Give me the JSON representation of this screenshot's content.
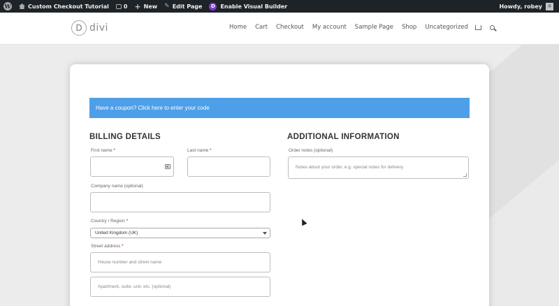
{
  "admin_bar": {
    "site_name": "Custom Checkout Tutorial",
    "comments_count": "0",
    "new_label": "New",
    "edit_page_label": "Edit Page",
    "visual_builder_label": "Enable Visual Builder",
    "greeting": "Howdy, robey"
  },
  "header": {
    "logo_letter": "D",
    "logo_text": "divi",
    "nav": [
      "Home",
      "Cart",
      "Checkout",
      "My account",
      "Sample Page",
      "Shop",
      "Uncategorized"
    ]
  },
  "checkout": {
    "coupon_text": "Have a coupon? Click here to enter your code",
    "billing": {
      "title": "BILLING DETAILS",
      "first_name_label": "First name",
      "last_name_label": "Last name",
      "company_label": "Company name (optional)",
      "country_label": "Country / Region",
      "country_value": "United Kingdom (UK)",
      "street_label": "Street address",
      "street_placeholder_1": "House number and street name",
      "street_placeholder_2": "Apartment, suite, unit, etc. (optional)",
      "required_mark": "*"
    },
    "additional": {
      "title": "ADDITIONAL INFORMATION",
      "notes_label": "Order notes (optional)",
      "notes_placeholder": "Notes about your order, e.g. special notes for delivery."
    }
  }
}
